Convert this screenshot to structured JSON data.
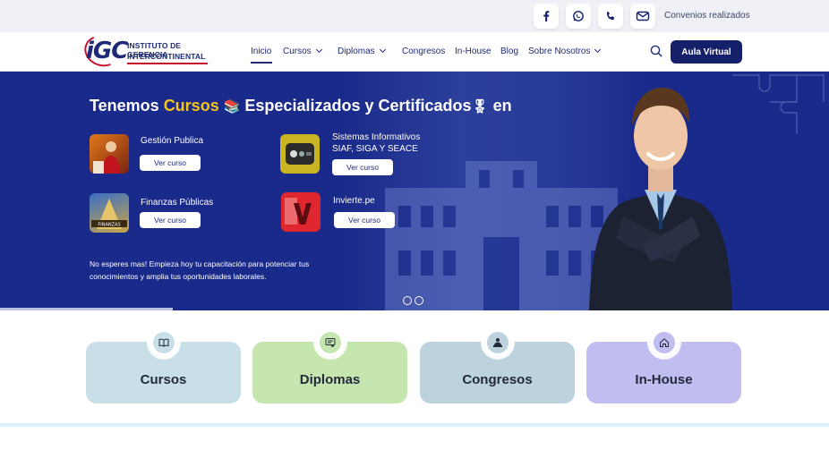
{
  "topbar": {
    "icons": [
      "facebook-icon",
      "whatsapp-icon",
      "phone-icon",
      "mail-icon"
    ],
    "link": "Convenios realizados"
  },
  "logo": {
    "mark": "iGC",
    "line1": "INSTITUTO DE GERENCIA",
    "line2": "INTERCONTINENTAL"
  },
  "nav": {
    "items": [
      "Inicio",
      "Cursos",
      "Diplomas",
      "Congresos",
      "In-House",
      "Blog",
      "Sobre Nosotros"
    ],
    "active": "Inicio",
    "cta": "Aula Virtual"
  },
  "hero": {
    "title_part1": "Tenemos ",
    "title_highlight": "Cursos",
    "title_part2": " Especializados y Certificados",
    "title_part3": " en",
    "courses": [
      {
        "name": "Gestión Publica",
        "button": "Ver curso"
      },
      {
        "name_line1": "Sistemas Informativos",
        "name_line2": "SIAF, SIGA Y SEACE",
        "button": "Ver curso"
      },
      {
        "name": "Finanzas Públicas",
        "button": "Ver curso"
      },
      {
        "name": "Invierte.pe",
        "button": "Ver curso"
      }
    ],
    "description": "No esperes mas! Empieza hoy tu capacitación para potenciar tus conocimientos y amplia tus oportunidades laborales.",
    "thumb_text_finanzas": "FINANZAS"
  },
  "cards": [
    {
      "label": "Cursos",
      "icon": "book-icon",
      "color": "#c9dfe8",
      "icon_bg": "#c9dfe8"
    },
    {
      "label": "Diplomas",
      "icon": "certificate-icon",
      "color": "#c6e6b0",
      "icon_bg": "#c6e6b0"
    },
    {
      "label": "Congresos",
      "icon": "presenter-icon",
      "color": "#bcd3dd",
      "icon_bg": "#bcd3dd"
    },
    {
      "label": "In-House",
      "icon": "home-icon",
      "color": "#c0bdf0",
      "icon_bg": "#c0bdf0"
    }
  ],
  "colors": {
    "brand_navy": "#14206a",
    "brand_red": "#c8102e",
    "hero_bg": "#1a2a8a",
    "highlight": "#f5c518"
  }
}
